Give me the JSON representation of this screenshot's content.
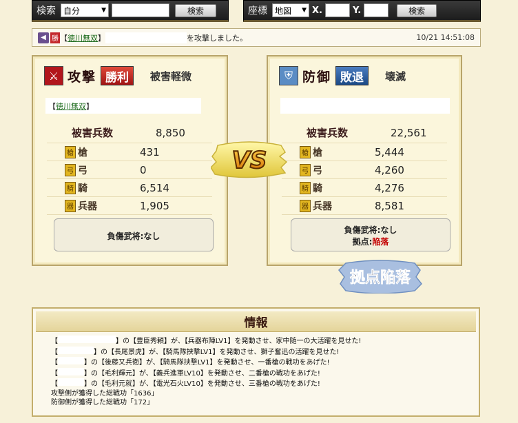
{
  "search_bar": {
    "label": "検索",
    "select_value": "自分",
    "input_value": "",
    "button_label": "検索"
  },
  "coord_bar": {
    "label": "座標",
    "select_value": "地図",
    "x_label": "X.",
    "x_value": "",
    "y_label": "Y.",
    "y_value": "",
    "button_label": "検索"
  },
  "message": {
    "icon": "mail-icon",
    "badge": "勝",
    "bracket_open": "【",
    "alliance": "徳川無双",
    "bracket_close": "】",
    "suffix": "を攻撃しました。",
    "time": "10/21 14:51:08"
  },
  "attacker": {
    "title": "攻撃",
    "result": "勝利",
    "damage_level": "被害軽微",
    "bracket_open": "【",
    "alliance": "徳川無双",
    "bracket_close": "】",
    "losses_label": "被害兵数",
    "losses_total": "8,850",
    "units": [
      {
        "icon": "spear-icon",
        "label": "槍",
        "value": "431"
      },
      {
        "icon": "bow-icon",
        "label": "弓",
        "value": "0"
      },
      {
        "icon": "horse-icon",
        "label": "騎",
        "value": "6,514"
      },
      {
        "icon": "siege-icon",
        "label": "兵器",
        "value": "1,905"
      }
    ],
    "injury_label": "負傷武将:",
    "injury_value": "なし"
  },
  "defender": {
    "title": "防御",
    "result": "敗退",
    "damage_level": "壊滅",
    "losses_label": "被害兵数",
    "losses_total": "22,561",
    "units": [
      {
        "icon": "spear-icon",
        "label": "槍",
        "value": "5,444"
      },
      {
        "icon": "bow-icon",
        "label": "弓",
        "value": "4,260"
      },
      {
        "icon": "horse-icon",
        "label": "騎",
        "value": "4,276"
      },
      {
        "icon": "siege-icon",
        "label": "兵器",
        "value": "8,581"
      }
    ],
    "injury_label": "負傷武将:",
    "injury_value": "なし",
    "base_label": "拠点:",
    "base_value": "陥落"
  },
  "vs_text": "VS",
  "base_fallen_badge": "拠点陥落",
  "info": {
    "title": "情報",
    "lines": [
      {
        "prefix": "【",
        "mid": "】の【豊臣秀頼】が、【兵器布陣LV1】を発動させ、家中随一の大活躍を見せた!"
      },
      {
        "prefix": "【",
        "mid": "】の【長尾景虎】が、【騎馬隊挟撃LV1】を発動させ、獅子奮迅の活躍を見せた!"
      },
      {
        "prefix": "【",
        "mid": "】の【後藤又兵衛】が、【騎馬隊挟撃LV1】を発動させ、一番槍の戦功をあげた!"
      },
      {
        "prefix": "【",
        "mid": "】の【毛利輝元】が、【義兵進軍LV10】を発動させ、二番槍の戦功をあげた!"
      },
      {
        "prefix": "【",
        "mid": "】の【毛利元就】が、【電光石火LV10】を発動させ、三番槍の戦功をあげた!"
      }
    ],
    "attack_merit": "攻撃側が獲得した総戦功「1636」",
    "defense_merit": "防御側が獲得した総戦功「172」"
  }
}
